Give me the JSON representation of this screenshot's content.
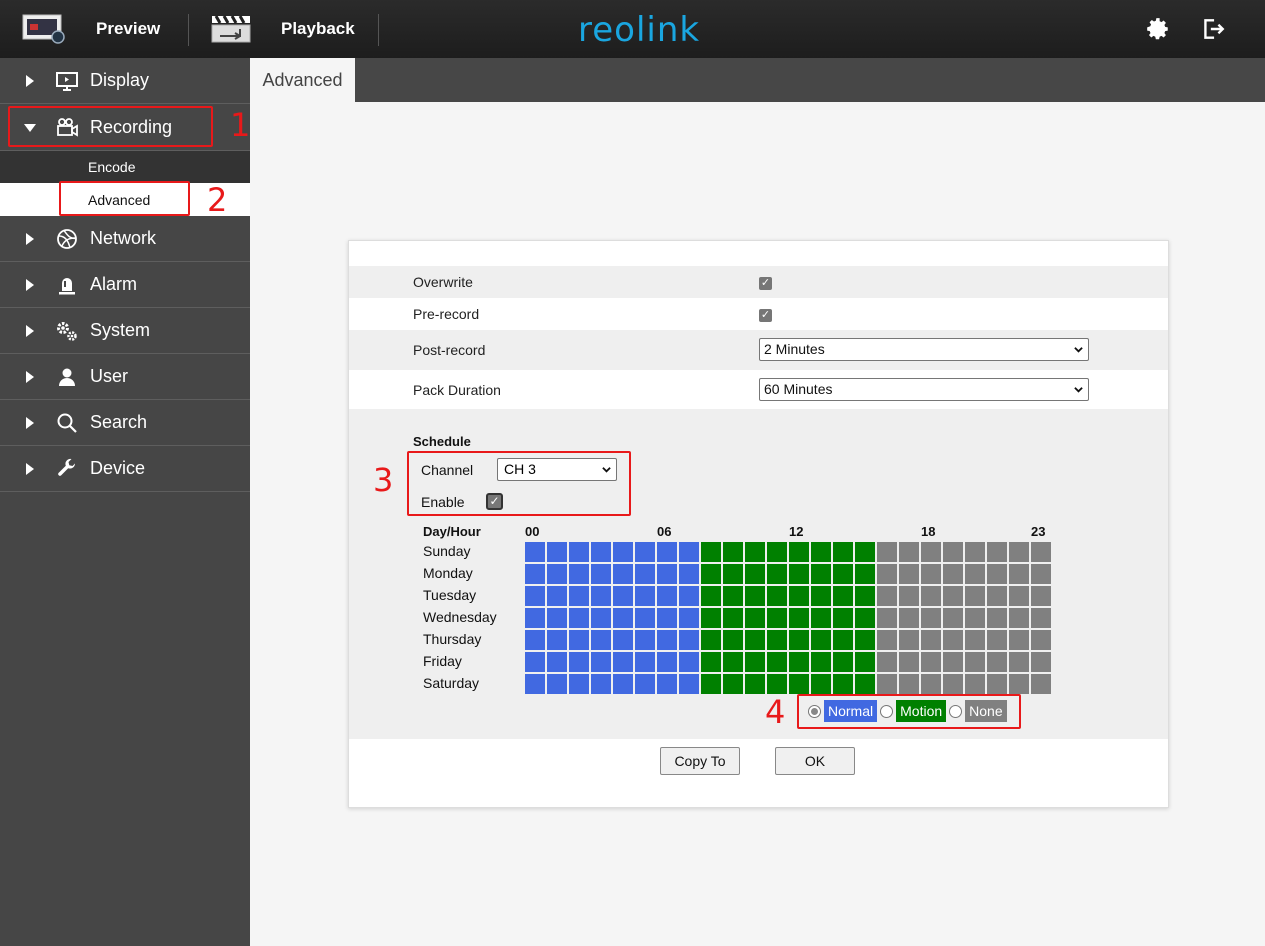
{
  "topbar": {
    "preview_label": "Preview",
    "playback_label": "Playback",
    "logo_text": "reolink",
    "logo_color": "#1aa6e0"
  },
  "sidebar": {
    "items": [
      {
        "label": "Display",
        "icon": "monitor-icon",
        "expanded": false
      },
      {
        "label": "Recording",
        "icon": "video-camera-icon",
        "expanded": true
      },
      {
        "label": "Network",
        "icon": "globe-icon",
        "expanded": false
      },
      {
        "label": "Alarm",
        "icon": "alarm-light-icon",
        "expanded": false
      },
      {
        "label": "System",
        "icon": "gears-icon",
        "expanded": false
      },
      {
        "label": "User",
        "icon": "user-icon",
        "expanded": false
      },
      {
        "label": "Search",
        "icon": "search-icon",
        "expanded": false
      },
      {
        "label": "Device",
        "icon": "wrench-icon",
        "expanded": false
      }
    ],
    "recording_sub": [
      {
        "label": "Encode",
        "selected": false
      },
      {
        "label": "Advanced",
        "selected": true
      }
    ]
  },
  "tab": {
    "label": "Advanced"
  },
  "form": {
    "overwrite_label": "Overwrite",
    "overwrite_checked": true,
    "prerecord_label": "Pre-record",
    "prerecord_checked": true,
    "postrecord_label": "Post-record",
    "postrecord_value": "2 Minutes",
    "pack_label": "Pack Duration",
    "pack_value": "60 Minutes"
  },
  "schedule": {
    "title": "Schedule",
    "channel_label": "Channel",
    "channel_value": "CH 3",
    "enable_label": "Enable",
    "enable_checked": true,
    "header_label": "Day/Hour",
    "hour_labels": [
      "00",
      "06",
      "12",
      "18",
      "23"
    ],
    "days": [
      "Sunday",
      "Monday",
      "Tuesday",
      "Wednesday",
      "Thursday",
      "Friday",
      "Saturday"
    ],
    "hour_modes": [
      "normal",
      "normal",
      "normal",
      "normal",
      "normal",
      "normal",
      "normal",
      "normal",
      "motion",
      "motion",
      "motion",
      "motion",
      "motion",
      "motion",
      "motion",
      "motion",
      "none",
      "none",
      "none",
      "none",
      "none",
      "none",
      "none",
      "none"
    ],
    "legend": {
      "selected": "normal",
      "normal_label": "Normal",
      "motion_label": "Motion",
      "none_label": "None",
      "normal_color": "#4169e1",
      "motion_color": "#008000",
      "none_color": "#808080"
    }
  },
  "buttons": {
    "copy_to": "Copy To",
    "ok": "OK"
  },
  "annotations": [
    "1",
    "2",
    "3",
    "4"
  ]
}
